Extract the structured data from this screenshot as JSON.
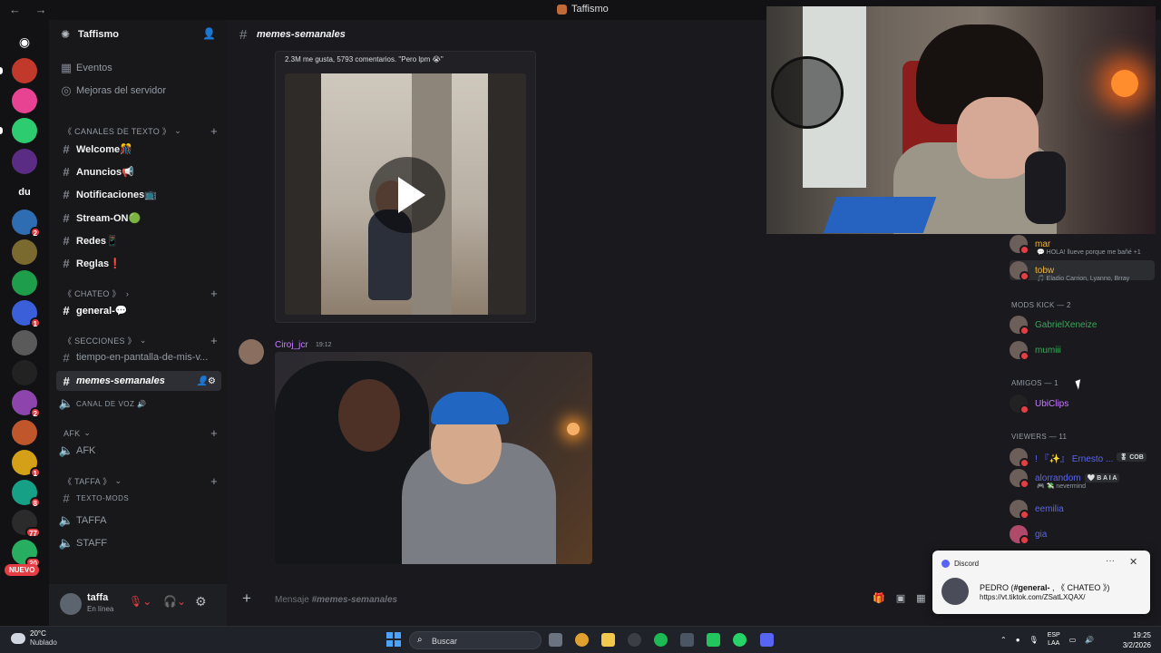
{
  "window": {
    "title": "Taffismo",
    "nav": "← →"
  },
  "servers": {
    "items": [
      {
        "icon": "discord-home-icon",
        "label": "",
        "color": "#121214"
      },
      {
        "icon": "server-avatar",
        "label": "",
        "color": "#c0392b"
      },
      {
        "icon": "server-avatar",
        "label": "",
        "color": "#e84393"
      },
      {
        "icon": "server-avatar",
        "label": "",
        "color": "#2ecc71"
      },
      {
        "icon": "server-avatar",
        "label": "",
        "color": "#5b2c83"
      },
      {
        "icon": "server-text",
        "label": "du",
        "color": "#121214"
      },
      {
        "icon": "server-avatar",
        "label": "",
        "color": "#2f6db3",
        "badge": "2"
      },
      {
        "icon": "server-avatar",
        "label": "",
        "color": "#7a6a30"
      },
      {
        "icon": "server-avatar",
        "label": "",
        "color": "#1e9e4a"
      },
      {
        "icon": "server-avatar",
        "label": "",
        "color": "#3a5fd8",
        "badge": "1"
      },
      {
        "icon": "server-avatar",
        "label": "",
        "color": "#5a5a5a"
      },
      {
        "icon": "server-avatar",
        "label": "",
        "color": "#222222"
      },
      {
        "icon": "server-avatar",
        "label": "",
        "color": "#8e44ad",
        "badge": "2"
      },
      {
        "icon": "server-avatar",
        "label": "",
        "color": "#c0562b"
      },
      {
        "icon": "server-avatar",
        "label": "",
        "color": "#d4a017",
        "badge": "1"
      },
      {
        "icon": "server-avatar",
        "label": "",
        "color": "#16a085",
        "badge": "8"
      },
      {
        "icon": "server-avatar",
        "label": "",
        "color": "#2b2b2b",
        "badge": "77"
      },
      {
        "icon": "server-avatar",
        "label": "",
        "color": "#27ae60",
        "badge": "20"
      }
    ],
    "new_label": "NUEVO"
  },
  "sidebar": {
    "server_name": "Taffismo",
    "top_items": [
      "Eventos",
      "Mejoras del servidor"
    ],
    "categories": {
      "texto": "《 CANALES DE TEXTO 》",
      "chateo": "《 CHATEO 》",
      "secciones": "《 SECCIONES 》",
      "afk": "AFK",
      "taffa": "《 TAFFA 》"
    },
    "channels": {
      "welcome": "Welcome🎊",
      "anuncios": "Anuncios📢",
      "notificaciones": "Notificaciones📺",
      "stream": "Stream-ON🟢",
      "redes": "Redes📱",
      "reglas": "Reglas❗",
      "general": "general-💬",
      "tiempo": "tiempo-en-pantalla-de-mis-v...",
      "memes": "memes-semanales",
      "canal_voz": "CANAL DE VOZ 🔊",
      "afk": "AFK",
      "texto_mods": "TEXTO-MODS",
      "taffa": "TAFFA",
      "staff": "STAFF"
    }
  },
  "user": {
    "name": "taffa",
    "status": "En línea"
  },
  "chat": {
    "channel_name": "memes-semanales",
    "embed_text": "2.3M me gusta, 5793 comentarios. \"Pero lpm 😭\"",
    "msg2_author": "Ciroj_jcr",
    "msg2_time": "19:12",
    "input_placeholder_prefix": "Mensaje ",
    "input_placeholder_channel": "#memes-semanales"
  },
  "members": {
    "top": [
      {
        "name": "mar",
        "sub": "💬 HOLA! llueve porque me bañé +1",
        "color": "#f0b232"
      },
      {
        "name": "tobw",
        "sub": "🎵 Eladio Carrion, Lyanno, Brray",
        "color": "#f0b232"
      }
    ],
    "mods_kick_header": "MODS KICK — 2",
    "mods_kick": [
      {
        "name": "GabrielXeneize",
        "color": "#3ba55c"
      },
      {
        "name": "mumiii",
        "color": "#3ba55c"
      }
    ],
    "amigos_header": "AMIGOS — 1",
    "amigos": [
      {
        "name": "UbiClips",
        "color": "#c77dff"
      }
    ],
    "viewers_header": "VIEWERS — 11",
    "viewers": [
      {
        "name": "! 『✨』 Ernesto ...",
        "tag": "🎖 COB",
        "color": "#5865f2"
      },
      {
        "name": "alorrandom",
        "tag": "🤍 B A I A",
        "sub": "🎮 💸 nevermind",
        "color": "#5865f2"
      },
      {
        "name": "eemilia",
        "color": "#5865f2"
      },
      {
        "name": "gia",
        "color": "#5865f2"
      }
    ]
  },
  "notification": {
    "app": "Discord",
    "line1_user": "PEDRO (",
    "line1_channel": "#general-",
    "line1_rest": " , 《 CHATEO 》)",
    "line2": "https://vt.tiktok.com/ZSatLXQAX/"
  },
  "taskbar": {
    "temp": "20°C",
    "weather": "Nublado",
    "search": "Buscar",
    "lang1": "ESP",
    "lang2": "LAA",
    "time": "19:25",
    "date": "3/2/2026"
  }
}
